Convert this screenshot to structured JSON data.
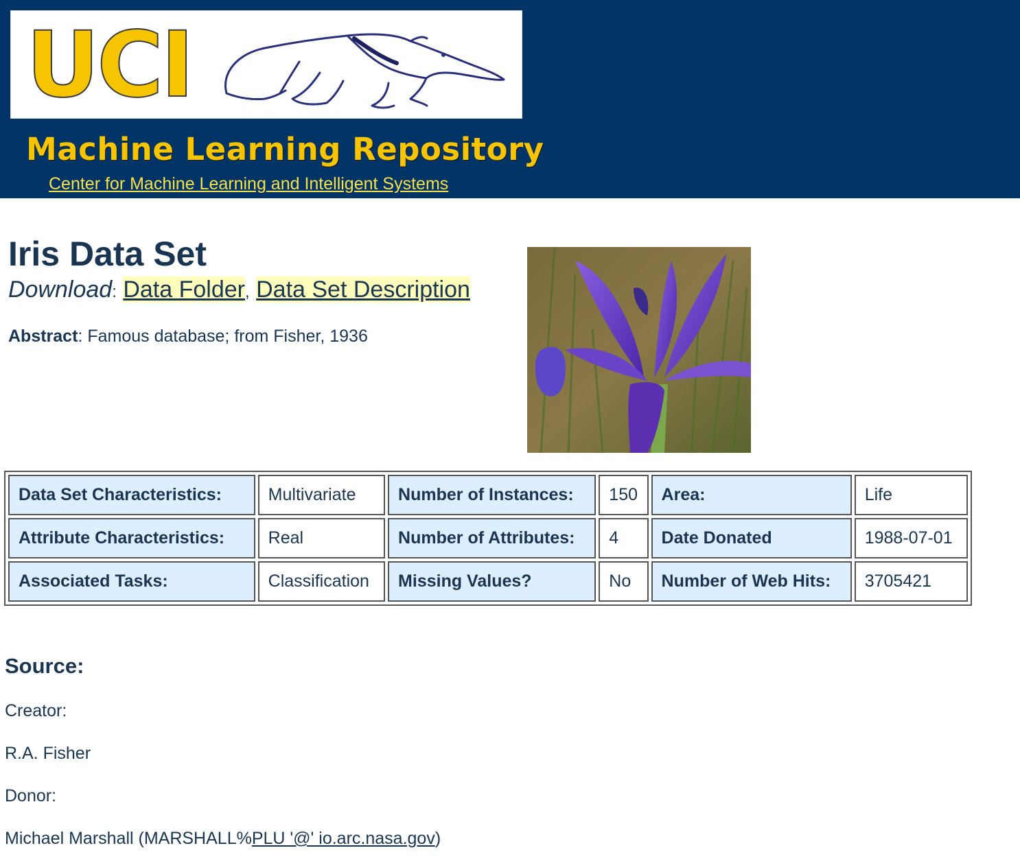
{
  "header": {
    "logo_text": "UCI",
    "repo_title": "Machine Learning Repository",
    "center_link": "Center for Machine Learning and Intelligent Systems"
  },
  "dataset": {
    "title": "Iris Data Set",
    "download_label": "Download",
    "download_sep1": ":",
    "download_link_folder": "Data Folder",
    "download_sep2": ",",
    "download_link_description": "Data Set Description",
    "abstract_label": "Abstract",
    "abstract_text": ": Famous database; from Fisher, 1936"
  },
  "stats_table": {
    "rows": [
      [
        "Data Set Characteristics:",
        "Multivariate",
        "Number of Instances:",
        "150",
        "Area:",
        "Life"
      ],
      [
        "Attribute Characteristics:",
        "Real",
        "Number of Attributes:",
        "4",
        "Date Donated",
        "1988-07-01"
      ],
      [
        "Associated Tasks:",
        "Classification",
        "Missing Values?",
        "No",
        "Number of Web Hits:",
        "3705421"
      ]
    ]
  },
  "source": {
    "heading": "Source:",
    "creator_label": "Creator:",
    "creator_name": "R.A. Fisher",
    "donor_label": "Donor:",
    "donor_prefix": "Michael Marshall (MARSHALL%",
    "donor_link": "PLU '@' io.arc.nasa.gov",
    "donor_suffix": ")"
  },
  "colors": {
    "banner_bg": "#003366",
    "logo_gold": "#f7c500",
    "label_cell_bg": "#ddeeff",
    "link_highlight": "#ffffbb",
    "text": "#1a3551"
  }
}
